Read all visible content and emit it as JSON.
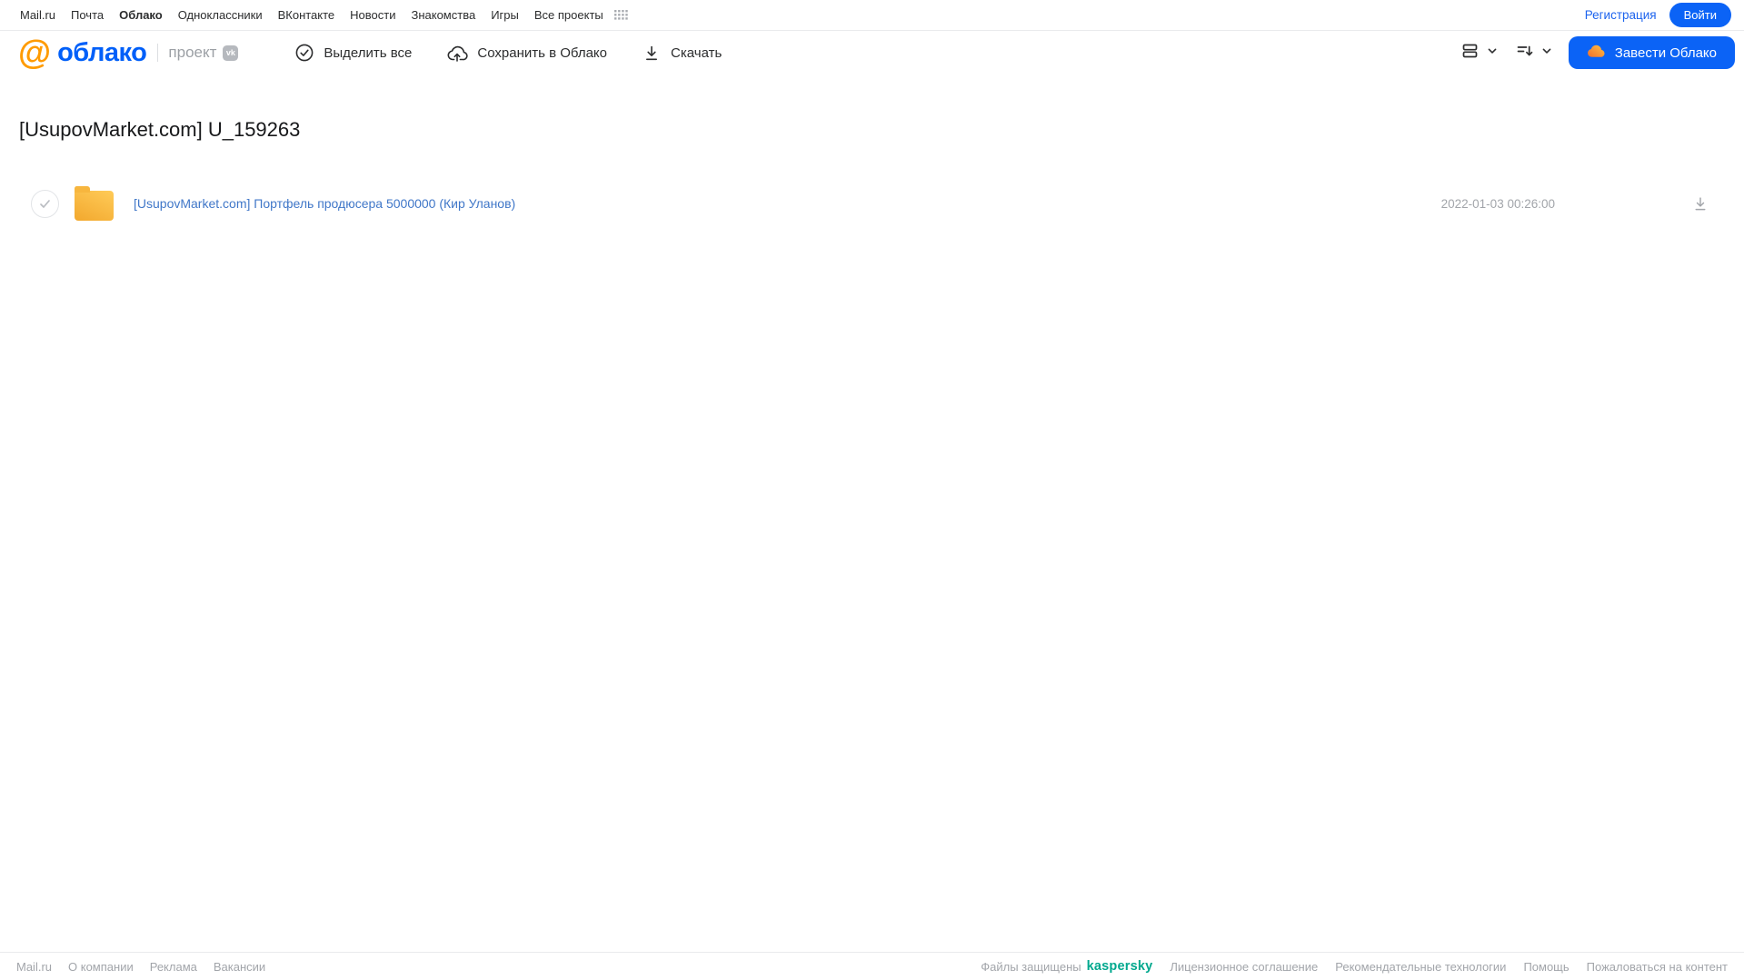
{
  "portal_nav": {
    "links": [
      "Mail.ru",
      "Почта",
      "Облако",
      "Одноклассники",
      "ВКонтакте",
      "Новости",
      "Знакомства",
      "Игры",
      "Все проекты"
    ],
    "active_link": "Облако",
    "registration": "Регистрация",
    "login": "Войти"
  },
  "header": {
    "logo_at": "@",
    "logo_text": "облако",
    "project_label": "проект",
    "vk_badge": "vk",
    "toolbar": [
      {
        "label": "Выделить все",
        "icon": "check-circle-icon"
      },
      {
        "label": "Сохранить в Облако",
        "icon": "cloud-upload-icon"
      },
      {
        "label": "Скачать",
        "icon": "download-icon"
      }
    ],
    "view_controls": [
      "view-mode-icon",
      "sort-icon"
    ],
    "get_cloud_button": "Завести Облако"
  },
  "main": {
    "title": "[UsupovMarket.com] U_159263",
    "files": [
      {
        "type": "folder",
        "name": "[UsupovMarket.com] Портфель продюсера 5000000 (Кир Уланов)",
        "date": "2022-01-03 00:26:00"
      }
    ]
  },
  "footer": {
    "left_links": [
      "Mail.ru",
      "О компании",
      "Реклама",
      "Вакансии"
    ],
    "protected_text": "Файлы защищены",
    "kaspersky": "kaspersky",
    "right_links": [
      "Лицензионное соглашение",
      "Рекомендательные технологии",
      "Помощь",
      "Пожаловаться на контент"
    ]
  },
  "colors": {
    "accent_blue": "#0b63f6",
    "logo_blue": "#005ff9",
    "logo_orange": "#ff9b00",
    "folder_yellow": "#f5b02e",
    "file_link_blue": "#4077c8",
    "kaspersky_teal": "#00a88e",
    "muted_gray": "#a2a5aa"
  }
}
